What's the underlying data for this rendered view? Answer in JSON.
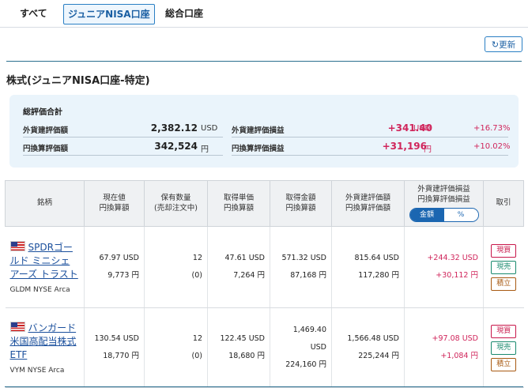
{
  "tabs": [
    {
      "label": "すべて"
    },
    {
      "label": "ジュニアNISA口座"
    },
    {
      "label": "総合口座"
    }
  ],
  "refresh_label": "更新",
  "section_title": "株式(ジュニアNISA口座-特定)",
  "summary": {
    "title": "総評価合計",
    "foreign_eval_label": "外貨建評価額",
    "foreign_eval_value": "2,382.12",
    "foreign_eval_unit": "USD",
    "yen_eval_label": "円換算評価額",
    "yen_eval_value": "342,524",
    "yen_eval_unit": "円",
    "foreign_pl_label": "外貨建評価損益",
    "foreign_pl_value": "+341.40",
    "foreign_pl_unit": "USD",
    "foreign_pl_pct": "+16.73%",
    "yen_pl_label": "円換算評価損益",
    "yen_pl_value": "+31,196",
    "yen_pl_unit": "円",
    "yen_pl_pct": "+10.02%"
  },
  "table": {
    "headers": {
      "name": "銘柄",
      "price_1": "現在値",
      "price_2": "円換算額",
      "qty_1": "保有数量",
      "qty_2": "(売却注文中)",
      "cost_1": "取得単価",
      "cost_2": "円換算額",
      "amount_1": "取得金額",
      "amount_2": "円換算額",
      "eval_1": "外貨建評価額",
      "eval_2": "円換算評価額",
      "pl_1": "外貨建評価損益",
      "pl_2": "円換算評価損益",
      "toggle_amount": "金額",
      "toggle_pct": "%",
      "trade": "取引"
    },
    "rows": [
      {
        "name": "SPDRゴールド ミニシェアーズ トラスト",
        "ticker": "GLDM NYSE Arca",
        "price_usd": "67.97 USD",
        "price_yen": "9,773 円",
        "qty": "12",
        "qty_sell": "(0)",
        "cost_usd": "47.61 USD",
        "cost_yen": "7,264 円",
        "amount_usd": "571.32 USD",
        "amount_yen": "87,168 円",
        "eval_usd": "815.64 USD",
        "eval_yen": "117,280 円",
        "pl_usd": "+244.32 USD",
        "pl_yen": "+30,112 円",
        "btn_buy": "現買",
        "btn_sell": "現売",
        "btn_accum": "積立"
      },
      {
        "name": "バンガード 米国高配当株式ETF",
        "ticker": "VYM NYSE Arca",
        "price_usd": "130.54 USD",
        "price_yen": "18,770 円",
        "qty": "12",
        "qty_sell": "(0)",
        "cost_usd": "122.45 USD",
        "cost_yen": "18,680 円",
        "amount_usd": "1,469.40 USD",
        "amount_yen": "224,160 円",
        "eval_usd": "1,566.48 USD",
        "eval_yen": "225,244 円",
        "pl_usd": "+97.08 USD",
        "pl_yen": "+1,084 円",
        "btn_buy": "現買",
        "btn_sell": "現売",
        "btn_accum": "積立"
      }
    ]
  }
}
